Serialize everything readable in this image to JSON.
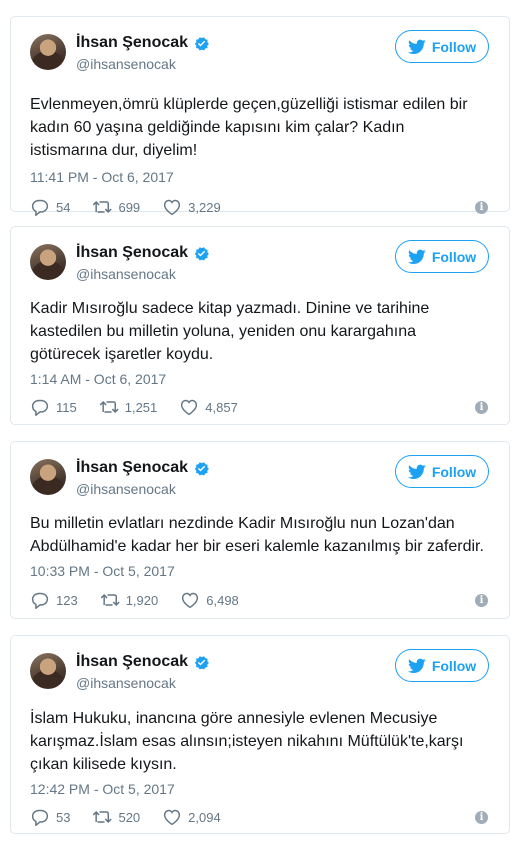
{
  "user": {
    "name": "İhsan Şenocak",
    "handle": "@ihsansenocak"
  },
  "follow_label": "Follow",
  "colors": {
    "accent": "#1da1f2",
    "muted": "#657786",
    "border": "#e1e8ed"
  },
  "icons": {
    "reply": "reply-icon",
    "retweet": "retweet-icon",
    "like": "heart-icon",
    "info": "info-icon",
    "verified": "verified-badge-icon",
    "bird": "twitter-bird-icon"
  },
  "tweets": [
    {
      "text": "Evlenmeyen,ömrü klüplerde geçen,güzelliği istismar edilen bir kadın 60 yaşına geldiğinde kapısını kim çalar? Kadın istismarına dur, diyelim!",
      "time": "11:41 PM - Oct 6, 2017",
      "replies": "54",
      "retweets": "699",
      "likes": "3,229"
    },
    {
      "text": "Kadir Mısıroğlu sadece kitap yazmadı. Dinine ve tarihine kastedilen bu milletin yoluna, yeniden onu karargahına götürecek işaretler koydu.",
      "time": "1:14 AM - Oct 6, 2017",
      "replies": "115",
      "retweets": "1,251",
      "likes": "4,857"
    },
    {
      "text": "Bu milletin evlatları nezdinde Kadir Mısıroğlu nun Lozan'dan Abdülhamid'e kadar her bir eseri kalemle kazanılmış bir zaferdir.",
      "time": "10:33 PM - Oct 5, 2017",
      "replies": "123",
      "retweets": "1,920",
      "likes": "6,498"
    },
    {
      "text": "İslam Hukuku, inancına göre annesiyle evlenen Mecusiye karışmaz.İslam esas alınsın;isteyen nikahını Müftülük'te,karşı çıkan kilisede kıysın.",
      "time": "12:42 PM - Oct 5, 2017",
      "replies": "53",
      "retweets": "520",
      "likes": "2,094"
    }
  ]
}
